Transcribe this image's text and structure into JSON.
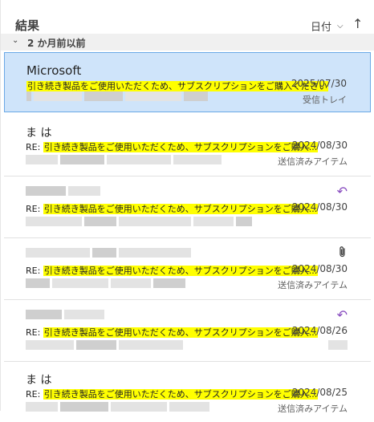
{
  "header": {
    "title": "結果",
    "sort_label": "日付",
    "sort_chevron": "⌵",
    "sort_direction": "↑"
  },
  "group": {
    "chevron": "⌄",
    "label": "2 か月前以前"
  },
  "messages": [
    {
      "sender": "Microsoft",
      "subject_prefix": "",
      "subject": "引き続き製品をご使用いただくため、サブスクリプションをご購入ください",
      "date": "2025/07/30",
      "folder": "受信トレイ",
      "selected": true
    },
    {
      "sender": "ま は",
      "subject_prefix": "RE: ",
      "subject": "引き続き製品をご使用いただくため、サブスクリプションをご購入...",
      "date": "2024/08/30",
      "folder": "送信済みアイテム"
    },
    {
      "sender": "",
      "subject_prefix": "RE: ",
      "subject": "引き続き製品をご使用いただくため、サブスクリプションをご購入...",
      "date": "2024/08/30",
      "folder": "",
      "icon": "reply-icon",
      "icon_glyph": "↶"
    },
    {
      "sender": "",
      "subject_prefix": "RE: ",
      "subject": "引き続き製品をご使用いただくため、サブスクリプションをご購入...",
      "date": "2024/08/30",
      "folder": "送信済みアイテム",
      "icon": "paperclip-icon",
      "icon_glyph": "⌀"
    },
    {
      "sender": "",
      "subject_prefix": "RE: ",
      "subject": "引き続き製品をご使用いただくため、サブスクリプションをご購入...",
      "date": "2024/08/26",
      "folder": "",
      "icon": "reply-icon",
      "icon_glyph": "↶"
    },
    {
      "sender": "ま は",
      "subject_prefix": "RE: ",
      "subject": "引き続き製品をご使用いただくため、サブスクリプションをご購入...",
      "date": "2024/08/25",
      "folder": "送信済みアイテム"
    }
  ],
  "colors": {
    "selected_bg": "#cfe4fa",
    "selected_border": "#6aa8e6",
    "highlight": "#ffff00",
    "reply_icon": "#8a4fc0",
    "group_bg": "#f0f0f0"
  }
}
